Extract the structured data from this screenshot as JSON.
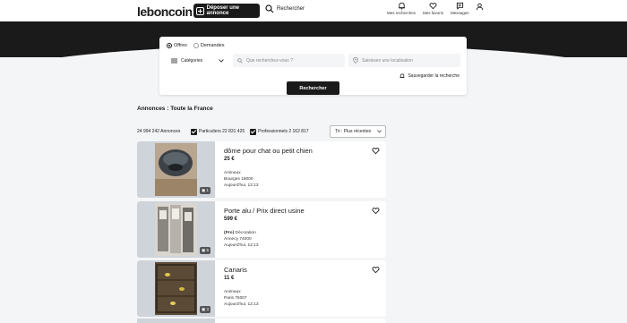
{
  "header": {
    "logo": "leboncoin",
    "post_label": "Déposer une annonce",
    "search_label": "Rechercher",
    "nav": [
      {
        "label": "Mes recherches",
        "icon": "bell-icon"
      },
      {
        "label": "Mes favoris",
        "icon": "heart-icon"
      },
      {
        "label": "Messages",
        "icon": "chat-icon"
      },
      {
        "label": "",
        "icon": "user-icon"
      }
    ]
  },
  "search": {
    "radio_offers": "Offres",
    "radio_requests": "Demandes",
    "category": "Catégories",
    "query_placeholder": "Que recherchez-vous ?",
    "location_placeholder": "Saisissez une localisation",
    "save_label": "Sauvegarder la recherche",
    "button_label": "Rechercher"
  },
  "listings": {
    "title": "Annonces : Toute la France",
    "count": "24 994 242 Annonces",
    "filter_private": "Particuliers 22 831 425",
    "filter_pro": "Professionnels 2 162 817",
    "sort": "Tri : Plus récentes",
    "items": [
      {
        "title": "dôme pour chat ou petit chien",
        "price": "25 €",
        "category": "Animaux",
        "location": "Bourges 18000",
        "date": "Aujourd'hui, 12:13",
        "photos": "1",
        "pro": false
      },
      {
        "title": "Porte alu / Prix direct usine",
        "price": "599 €",
        "category": "Décoration",
        "pro_label": "(Pro)",
        "location": "Annecy 74000",
        "date": "Aujourd'hui, 12:13",
        "photos": "5",
        "pro": true
      },
      {
        "title": "Canaris",
        "price": "11 €",
        "category": "Animaux",
        "location": "Paris 75007",
        "date": "Aujourd'hui, 12:13",
        "photos": "3",
        "pro": false
      }
    ]
  },
  "colors": {
    "dark": "#1a1a1a",
    "background": "#f4f5f7",
    "card": "#ffffff",
    "image_bg": "#cfd3da"
  }
}
